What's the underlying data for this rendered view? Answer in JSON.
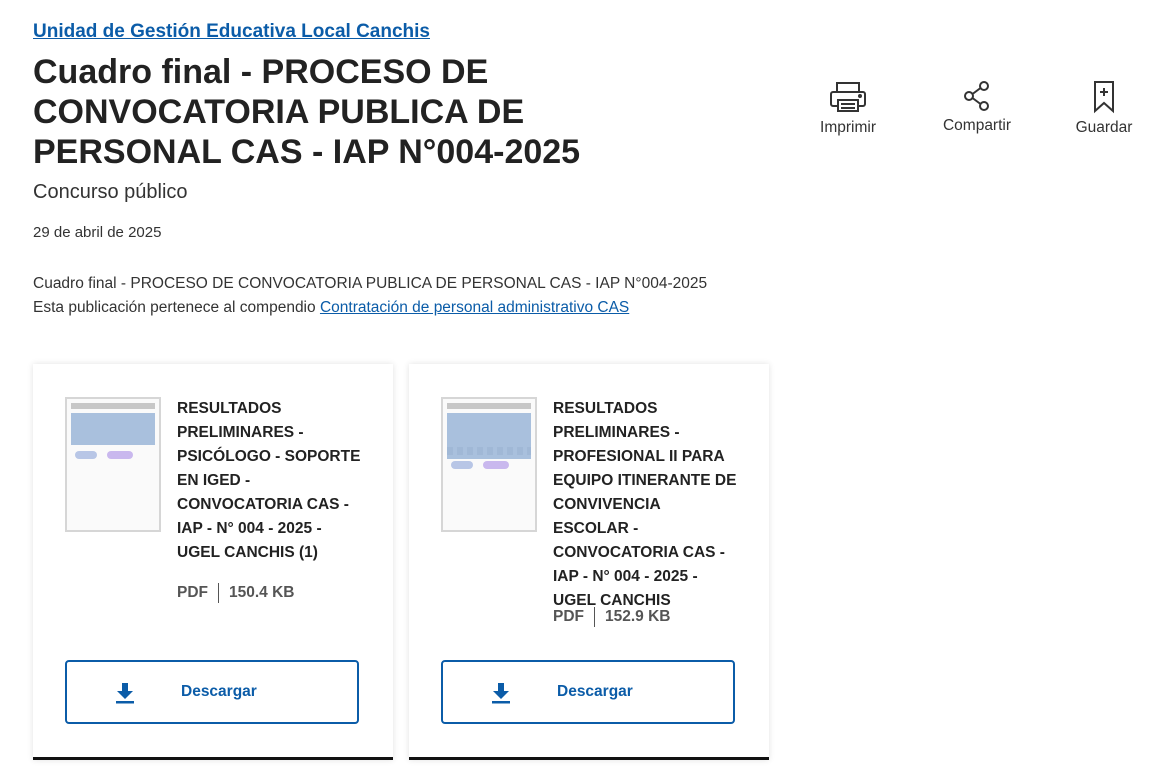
{
  "header": {
    "org_link": "Unidad de Gestión Educativa Local Canchis",
    "title": "Cuadro final - PROCESO DE CONVOCATORIA PUBLICA DE PERSONAL CAS - IAP N°004-2025",
    "subtitle": "Concurso público",
    "date": "29 de abril de 2025"
  },
  "actions": {
    "print": "Imprimir",
    "share": "Compartir",
    "save": "Guardar"
  },
  "description": {
    "line1": "Cuadro final - PROCESO DE CONVOCATORIA PUBLICA DE PERSONAL CAS - IAP N°004-2025",
    "line2_prefix": "Esta publicación pertenece al compendio",
    "compendium_link": "Contratación de personal administrativo CAS"
  },
  "documents": [
    {
      "title": "RESULTADOS PRELIMINARES - PSICÓLOGO - SOPORTE EN IGED - CONVOCATORIA CAS - IAP - N° 004 - 2025 - UGEL CANCHIS (1)",
      "format": "PDF",
      "size": "150.4 KB",
      "button": "Descargar"
    },
    {
      "title": "RESULTADOS PRELIMINARES - PROFESIONAL II PARA EQUIPO ITINERANTE DE CONVIVENCIA ESCOLAR - CONVOCATORIA CAS - IAP - N° 004 - 2025 - UGEL CANCHIS",
      "format": "PDF",
      "size": "152.9 KB",
      "button": "Descargar"
    }
  ],
  "colors": {
    "link": "#0b5ca8",
    "text": "#222222",
    "card_border_bottom": "#111111"
  },
  "icons": {
    "print": "printer-icon",
    "share": "share-icon",
    "save": "bookmark-icon",
    "download": "download-icon"
  }
}
